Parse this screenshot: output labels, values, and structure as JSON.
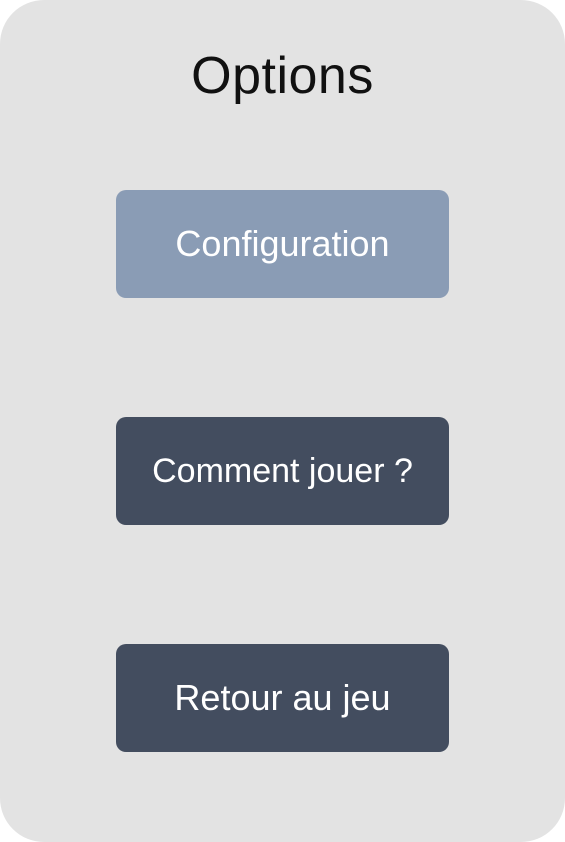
{
  "options_menu": {
    "title": "Options",
    "buttons": [
      {
        "label": "Configuration",
        "state": "selected"
      },
      {
        "label": "Comment jouer ?",
        "state": "default"
      },
      {
        "label": "Retour au jeu",
        "state": "default"
      }
    ]
  },
  "colors": {
    "panel_background": "#e3e3e3",
    "button_selected": "#8a9cb5",
    "button_default": "#434d5f",
    "button_text": "#ffffff",
    "title_text": "#111111"
  }
}
